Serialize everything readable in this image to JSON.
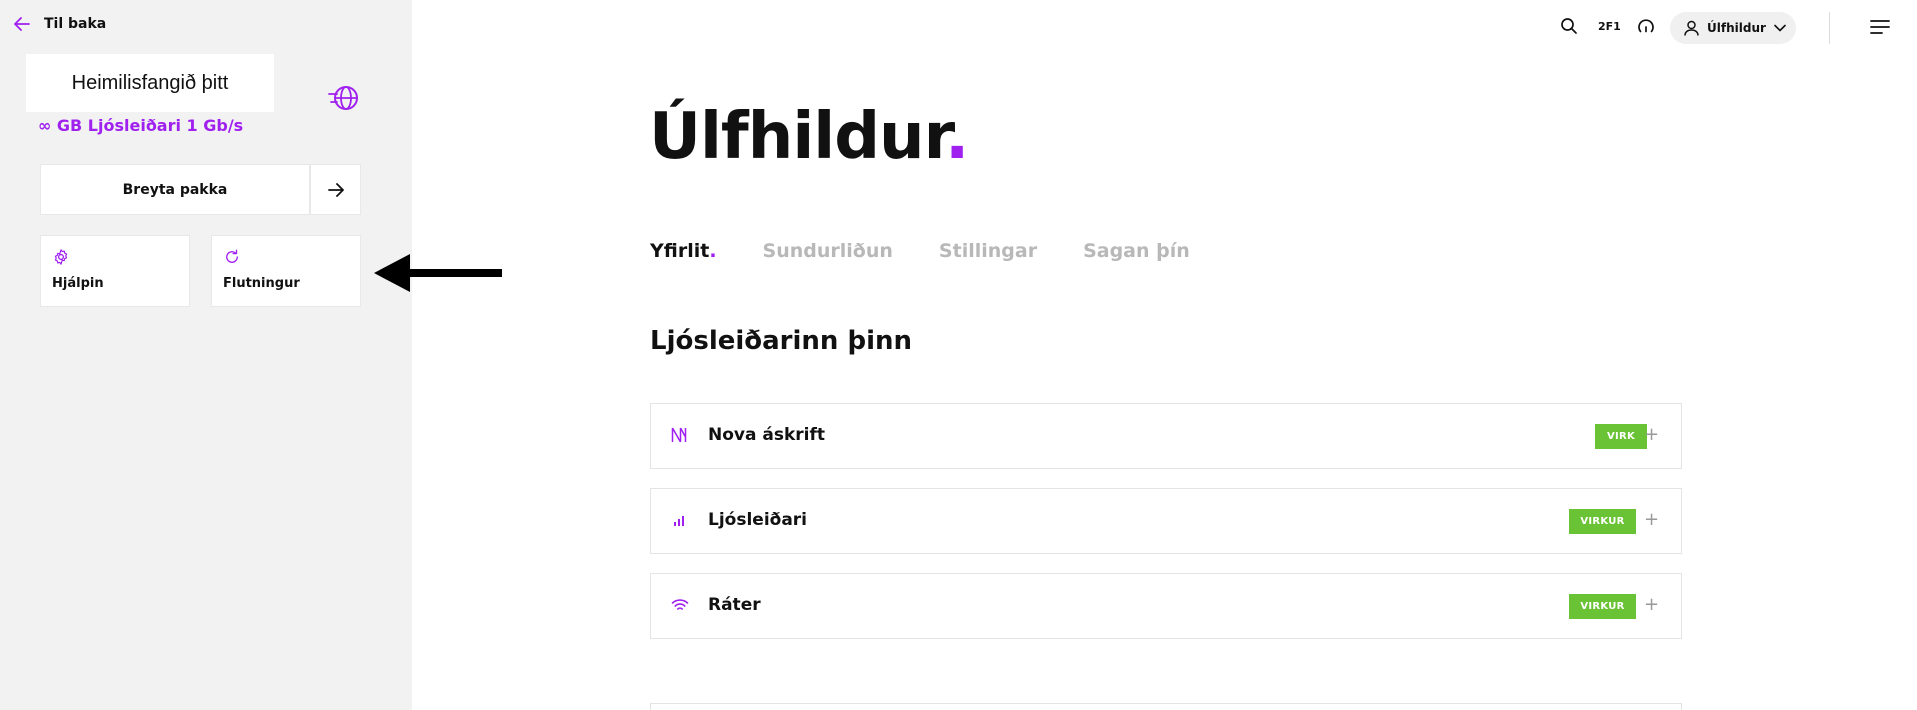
{
  "sidebar": {
    "back_label": "Til baka",
    "address_label": "Heimilisfangið þitt",
    "plan_label": "∞ GB Ljósleiðari 1 Gb/s",
    "change_button_label": "Breyta pakka",
    "tiles": [
      {
        "label": "Hjálpin",
        "icon": "gear-icon"
      },
      {
        "label": "Flutningur",
        "icon": "refresh-icon"
      }
    ]
  },
  "header": {
    "twofone_label": "2F1",
    "user_name": "Úlfhildur"
  },
  "main": {
    "title": "Úlfhildur",
    "title_dot": ".",
    "tabs": [
      {
        "label": "Yfirlit",
        "active": true
      },
      {
        "label": "Sundurliðun",
        "active": false
      },
      {
        "label": "Stillingar",
        "active": false
      },
      {
        "label": "Sagan þín",
        "active": false
      }
    ],
    "section_title": "Ljósleiðarinn þinn",
    "cards": [
      {
        "name": "Nova áskrift",
        "status": "VIRK",
        "icon": "nova-logo-icon"
      },
      {
        "name": "Ljósleiðari",
        "status": "VIRKUR",
        "icon": "signal-bars-icon"
      },
      {
        "name": "Ráter",
        "status": "VIRKUR",
        "icon": "wifi-icon"
      }
    ]
  },
  "colors": {
    "accent": "#a020f0",
    "status_green": "#6ac235",
    "sidebar_bg": "#f2f2f2"
  }
}
